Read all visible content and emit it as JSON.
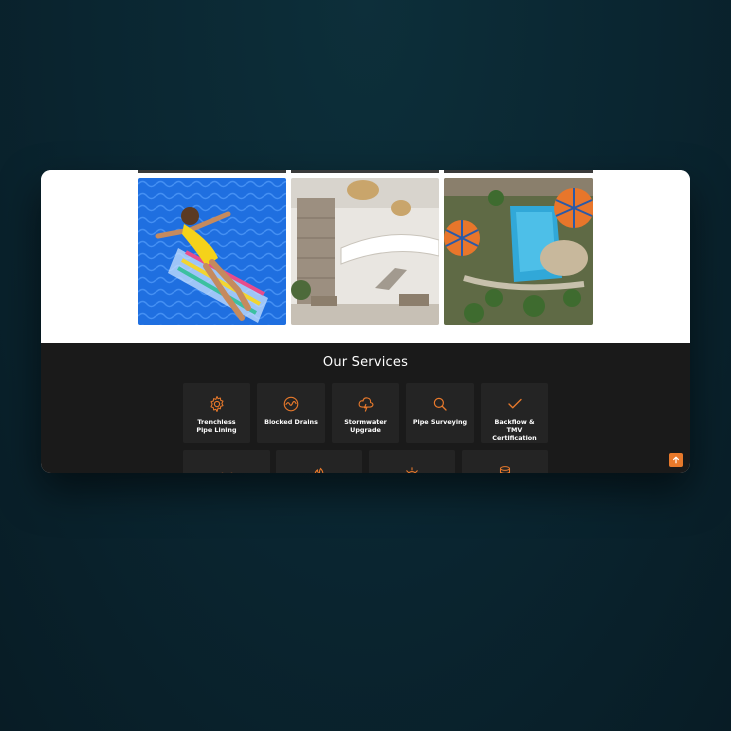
{
  "colors": {
    "accent": "#e8792b",
    "services_bg": "#1a1a1a",
    "card_bg": "#242424",
    "page_bg": "#0a2530"
  },
  "gallery": {
    "photos": [
      {
        "alt": "woman relaxing on inflatable in pool",
        "icon": "pool-photo"
      },
      {
        "alt": "modern interior with curved staircase",
        "icon": "interior-photo"
      },
      {
        "alt": "aerial view of water park",
        "icon": "waterpark-photo"
      }
    ]
  },
  "services": {
    "title": "Our Services",
    "row1": [
      {
        "label": "Trenchless Pipe Lining",
        "icon": "gear-icon"
      },
      {
        "label": "Blocked Drains",
        "icon": "wave-circle-icon"
      },
      {
        "label": "Stormwater Upgrade",
        "icon": "storm-cloud-icon"
      },
      {
        "label": "Pipe Surveying",
        "icon": "magnifier-icon"
      },
      {
        "label": "Backflow & TMV Certification",
        "icon": "checkmark-icon"
      }
    ],
    "row2": [
      {
        "icon": "waves-icon"
      },
      {
        "icon": "flame-icon"
      },
      {
        "icon": "sun-icon"
      },
      {
        "icon": "tank-icon"
      }
    ]
  },
  "scroll_to_top": {
    "icon": "arrow-up-icon"
  }
}
